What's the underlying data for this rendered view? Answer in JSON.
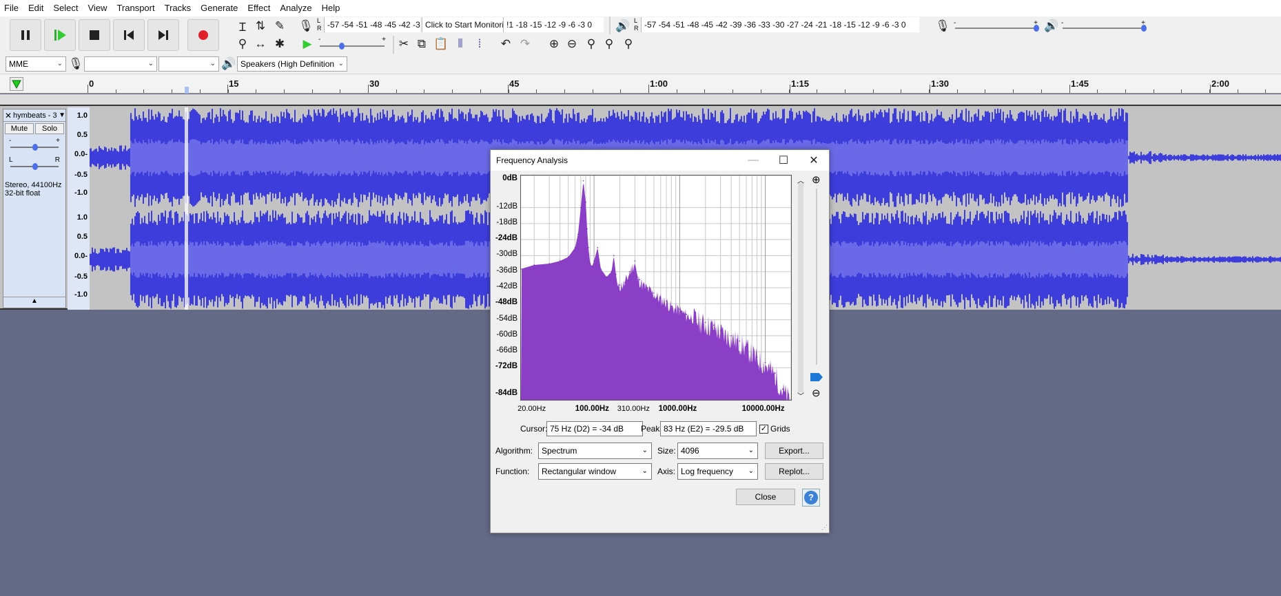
{
  "menu": [
    "File",
    "Edit",
    "Select",
    "View",
    "Transport",
    "Tracks",
    "Generate",
    "Effect",
    "Analyze",
    "Help"
  ],
  "meters": {
    "record_scale": "-57 -54 -51 -48 -45 -42 -3",
    "monitor_prompt": "Click to Start Monitoring",
    "record_scale_tail": "!1 -18 -15 -12  -9  -6  -3  0",
    "playback_scale": "-57 -54 -51 -48 -45 -42 -39 -36 -33 -30 -27 -24 -21 -18 -15 -12  -9  -6  -3  0",
    "lr_top": "L",
    "lr_bottom": "R"
  },
  "device": {
    "host": "MME",
    "record_device": "",
    "channels": "",
    "playback_device": "Speakers (High Definition"
  },
  "slider_marks": {
    "minus": "-",
    "plus": "+"
  },
  "timeline": {
    "ticks": [
      {
        "label": "0",
        "x": 131
      },
      {
        "label": "15",
        "x": 334
      },
      {
        "label": "30",
        "x": 538
      },
      {
        "label": "45",
        "x": 741
      },
      {
        "label": "1:00",
        "x": 945
      },
      {
        "label": "1:15",
        "x": 1150
      },
      {
        "label": "1:30",
        "x": 1353
      },
      {
        "label": "1:45",
        "x": 1556
      },
      {
        "label": "2:00",
        "x": 1760
      }
    ]
  },
  "track": {
    "name": "hymbeats - 3",
    "mute": "Mute",
    "solo": "Solo",
    "gain_minus": "-",
    "gain_plus": "+",
    "pan_l": "L",
    "pan_r": "R",
    "info": "Stereo, 44100Hz",
    "format": "32-bit float",
    "ruler": [
      "1.0",
      "0.5",
      "0.0-",
      "-0.5",
      "-1.0"
    ],
    "ruler2": [
      "1.0",
      "0.5",
      "0.0-",
      "-0.5",
      "-1.0"
    ],
    "wave_color": "#3d3ddb"
  },
  "dialog": {
    "title": "Frequency Analysis",
    "db_labels": [
      {
        "text": "0dB",
        "bold": true
      },
      {
        "text": "-12dB",
        "bold": false
      },
      {
        "text": "-18dB",
        "bold": false
      },
      {
        "text": "-24dB",
        "bold": true
      },
      {
        "text": "-30dB",
        "bold": false
      },
      {
        "text": "-36dB",
        "bold": false
      },
      {
        "text": "-42dB",
        "bold": false
      },
      {
        "text": "-48dB",
        "bold": true
      },
      {
        "text": "-54dB",
        "bold": false
      },
      {
        "text": "-60dB",
        "bold": false
      },
      {
        "text": "-66dB",
        "bold": false
      },
      {
        "text": "-72dB",
        "bold": true
      },
      {
        "text": "-84dB",
        "bold": true
      }
    ],
    "freq_labels": [
      {
        "text": "20.00Hz",
        "bold": false
      },
      {
        "text": "100.00Hz",
        "bold": true
      },
      {
        "text": "310.00Hz",
        "bold": false
      },
      {
        "text": "1000.00Hz",
        "bold": true
      },
      {
        "text": "10000.00Hz",
        "bold": true
      }
    ],
    "cursor_label": "Cursor:",
    "cursor_value": "75 Hz (D2) = -34 dB",
    "peak_label": "Peak:",
    "peak_value": "83 Hz (E2) = -29.5 dB",
    "grids_label": "Grids",
    "algorithm_label": "Algorithm:",
    "algorithm_value": "Spectrum",
    "size_label": "Size:",
    "size_value": "4096",
    "function_label": "Function:",
    "function_value": "Rectangular window",
    "axis_label": "Axis:",
    "axis_value": "Log frequency",
    "export_label": "Export...",
    "replot_label": "Replot...",
    "close_label": "Close",
    "help_label": "?",
    "spectrum_color": "#8b3fc6"
  },
  "chart_data": {
    "type": "area",
    "title": "",
    "xlabel": "",
    "ylabel": "",
    "x_scale": "log",
    "xlim": [
      14,
      20000
    ],
    "ylim": [
      -84,
      0
    ],
    "x_ticks": [
      "20.00Hz",
      "100.00Hz",
      "310.00Hz",
      "1000.00Hz",
      "10000.00Hz"
    ],
    "y_ticks": [
      "0dB",
      "-12dB",
      "-18dB",
      "-24dB",
      "-30dB",
      "-36dB",
      "-42dB",
      "-48dB",
      "-54dB",
      "-60dB",
      "-66dB",
      "-72dB",
      "-84dB"
    ],
    "grid": true,
    "x": [
      14,
      20,
      30,
      40,
      50,
      60,
      65,
      70,
      75,
      80,
      83,
      86,
      90,
      95,
      100,
      110,
      120,
      140,
      160,
      170,
      180,
      190,
      200,
      230,
      260,
      300,
      320,
      340,
      380,
      420,
      500,
      600,
      700,
      800,
      1000,
      1200,
      1500,
      2000,
      2500,
      3000,
      4000,
      5000,
      6000,
      8000,
      10000,
      13000,
      16000,
      20000
    ],
    "values": [
      -35,
      -33.5,
      -33,
      -32,
      -30.5,
      -27,
      -22,
      -12,
      -2,
      -10,
      -20,
      -27,
      -33,
      -34,
      -32,
      -27,
      -35,
      -38,
      -36,
      -30,
      -37,
      -42,
      -41,
      -40,
      -36,
      -32,
      -38,
      -39,
      -41,
      -42,
      -44,
      -46,
      -47,
      -49,
      -50,
      -52,
      -53,
      -55,
      -56,
      -58,
      -60,
      -62,
      -64,
      -68,
      -70,
      -74,
      -80,
      -84
    ]
  }
}
